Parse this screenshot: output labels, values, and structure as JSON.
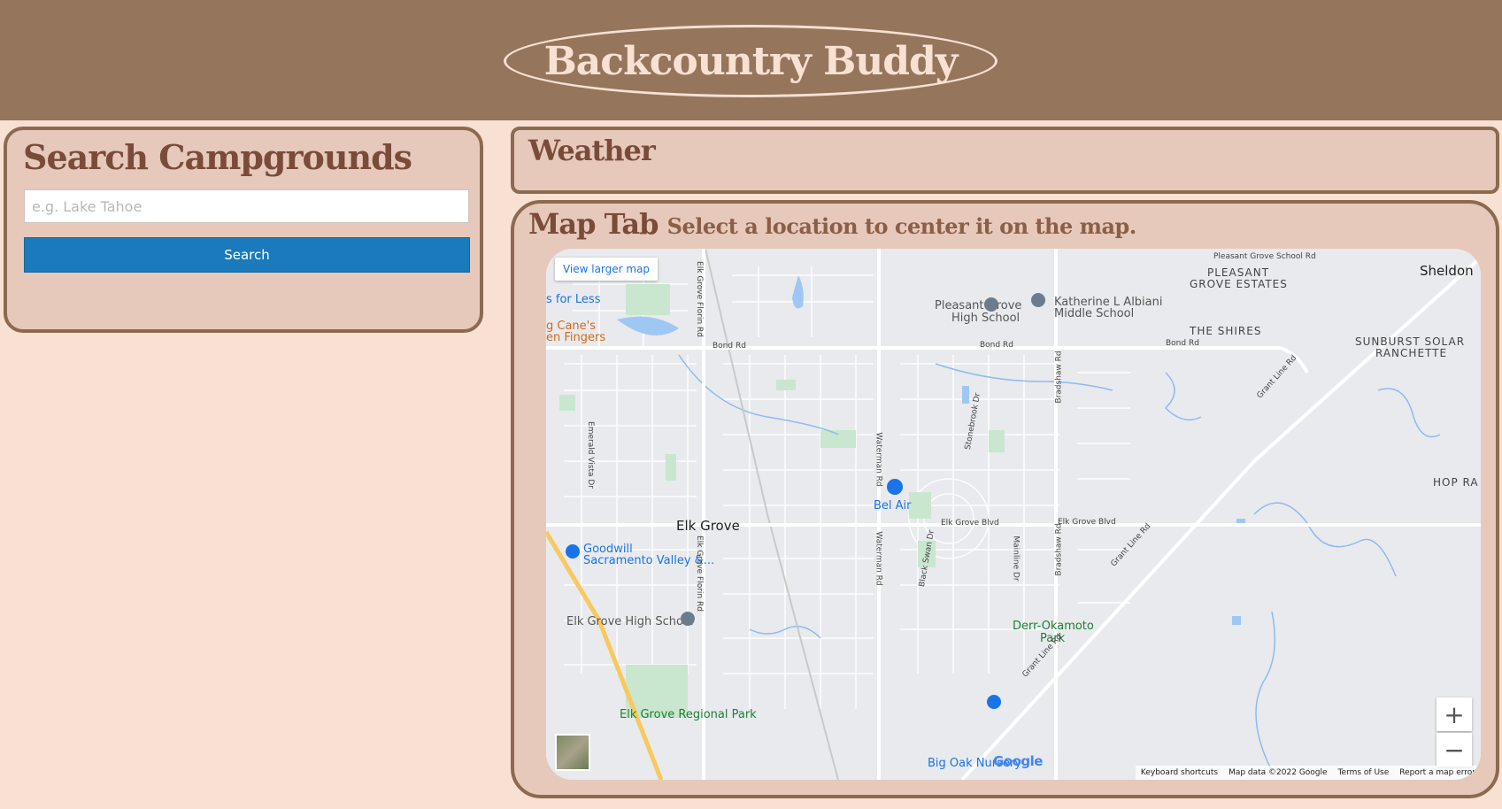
{
  "header": {
    "title": "Backcountry Buddy"
  },
  "search": {
    "title": "Search Campgrounds",
    "placeholder": "e.g. Lake Tahoe",
    "button_label": "Search"
  },
  "weather": {
    "title": "Weather"
  },
  "map_tab": {
    "title": "Map Tab",
    "subtitle": "Select a location to center it on the map.",
    "view_larger": "View larger map",
    "zoom_in": "+",
    "zoom_out": "−",
    "google_logo": "Google",
    "attribution": [
      "Keyboard shortcuts",
      "Map data ©2022 Google",
      "Terms of Use",
      "Report a map error"
    ],
    "places": [
      {
        "name": "Elk Grove",
        "kind": "town"
      },
      {
        "name": "Sheldon",
        "kind": "town"
      },
      {
        "name": "PLEASANT",
        "kind": "area"
      },
      {
        "name": "GROVE ESTATES",
        "kind": "area"
      },
      {
        "name": "THE SHIRES",
        "kind": "area"
      },
      {
        "name": "SUNBURST SOLAR",
        "kind": "area"
      },
      {
        "name": "RANCHETTE",
        "kind": "area"
      },
      {
        "name": "HOP RA",
        "kind": "area"
      },
      {
        "name": "Pleasant Grove",
        "kind": "poi"
      },
      {
        "name": "High School",
        "kind": "poi"
      },
      {
        "name": "Katherine L Albiani",
        "kind": "poi"
      },
      {
        "name": "Middle School",
        "kind": "poi"
      },
      {
        "name": "Bel Air",
        "kind": "poi"
      },
      {
        "name": "Goodwill",
        "kind": "poi"
      },
      {
        "name": "Sacramento Valley &...",
        "kind": "poi"
      },
      {
        "name": "Elk Grove High School",
        "kind": "poi"
      },
      {
        "name": "Derr-Okamoto",
        "kind": "park"
      },
      {
        "name": "Park",
        "kind": "park"
      },
      {
        "name": "Elk Grove Regional Park",
        "kind": "park"
      },
      {
        "name": "Big Oak Nursery",
        "kind": "poi"
      },
      {
        "name": "s for Less",
        "kind": "poi"
      },
      {
        "name": "g Cane's",
        "kind": "food"
      },
      {
        "name": "en Fingers",
        "kind": "food"
      }
    ],
    "roads": [
      "Bond Rd",
      "Bond Rd",
      "Bond Rd",
      "Elk Grove Blvd",
      "Elk Grove Blvd",
      "Elk Grove Florin Rd",
      "Elk Grove Florin Rd",
      "Waterman Rd",
      "Waterman Rd",
      "Bradshaw Rd",
      "Bradshaw Rd",
      "Grant Line Rd",
      "Grant Line Rd",
      "Grant Line Rd",
      "Emerald Vista Dr",
      "Stonebrook Dr",
      "Black Swan Dr",
      "Mainline Dr",
      "Pleasant Grove School Rd"
    ]
  }
}
